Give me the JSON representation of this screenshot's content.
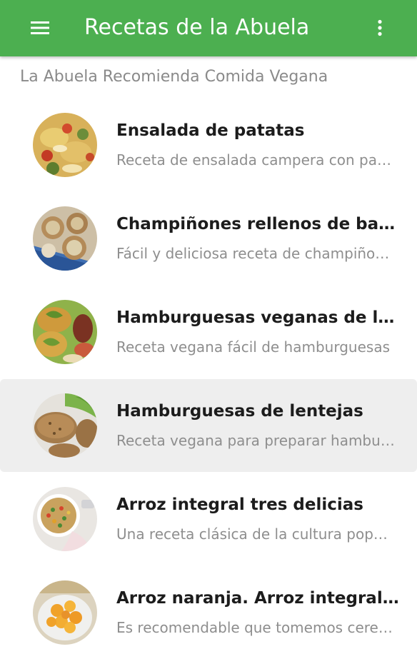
{
  "app_bar": {
    "title": "Recetas de la Abuela",
    "color": "#4caf50",
    "menu_icon": "hamburger-menu-icon",
    "overflow_icon": "more-vert-icon"
  },
  "subheader": "La Abuela Recomienda Comida Vegana",
  "recipes": [
    {
      "title": "Ensalada de patatas",
      "description": "Receta de ensalada campera con patatas",
      "thumbnail": "potato-salad-photo",
      "selected": false
    },
    {
      "title": "Champiñones rellenos de batata",
      "description": "Fácil y deliciosa receta de champiñones",
      "thumbnail": "stuffed-mushrooms-photo",
      "selected": false
    },
    {
      "title": "Hamburguesas veganas de lentejas",
      "description": "Receta vegana fácil de hamburguesas",
      "thumbnail": "vegan-burgers-photo",
      "selected": false
    },
    {
      "title": "Hamburguesas de lentejas",
      "description": "Receta vegana para preparar hamburguesas",
      "thumbnail": "lentil-burgers-photo",
      "selected": true
    },
    {
      "title": "Arroz integral tres delicias",
      "description": "Una receta clásica de la cultura popular",
      "thumbnail": "fried-rice-photo",
      "selected": false
    },
    {
      "title": "Arroz naranja. Arroz integral con",
      "description": "Es recomendable que tomemos cereales",
      "thumbnail": "orange-rice-photo",
      "selected": false
    }
  ]
}
